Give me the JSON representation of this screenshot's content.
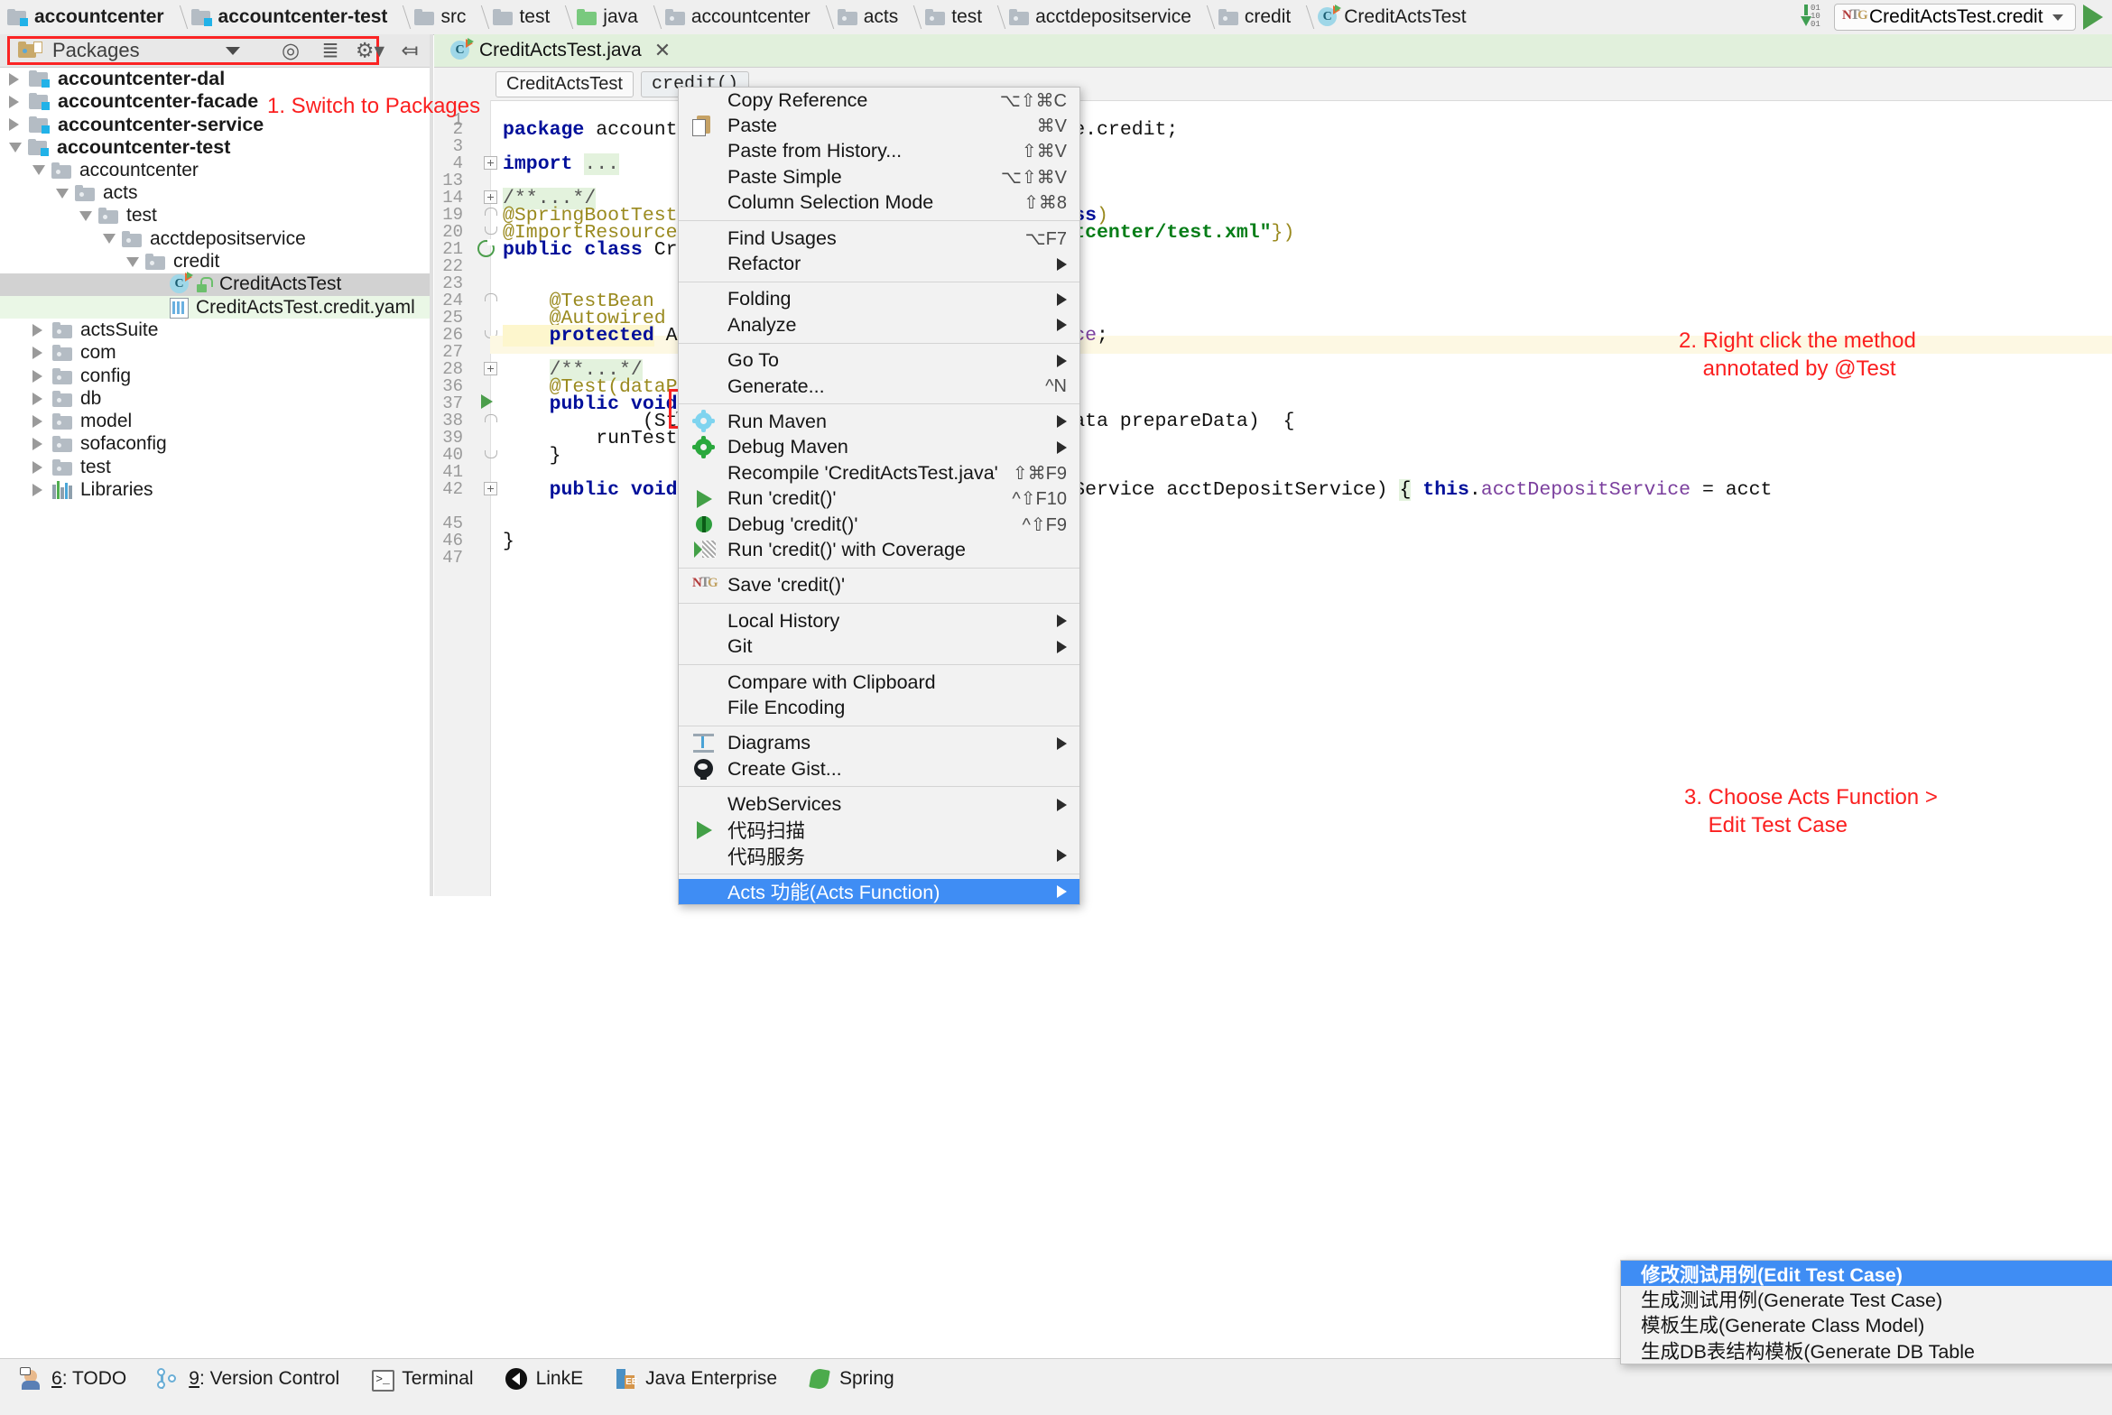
{
  "breadcrumb": [
    {
      "label": "accountcenter",
      "icon": "module-icon",
      "bold": true
    },
    {
      "label": "accountcenter-test",
      "icon": "module-icon",
      "bold": true
    },
    {
      "label": "src",
      "icon": "folder-icon",
      "bold": false
    },
    {
      "label": "test",
      "icon": "folder-icon",
      "bold": false
    },
    {
      "label": "java",
      "icon": "source-folder-icon",
      "bold": false
    },
    {
      "label": "accountcenter",
      "icon": "package-icon",
      "bold": false
    },
    {
      "label": "acts",
      "icon": "package-icon",
      "bold": false
    },
    {
      "label": "test",
      "icon": "package-icon",
      "bold": false
    },
    {
      "label": "acctdepositservice",
      "icon": "package-icon",
      "bold": false
    },
    {
      "label": "credit",
      "icon": "package-icon",
      "bold": false
    },
    {
      "label": "CreditActsTest",
      "icon": "java-class-icon",
      "bold": false
    }
  ],
  "toolbar": {
    "binary_icon": "binary-download-icon",
    "binary_bits": [
      "01",
      "10",
      "01"
    ],
    "run_config": "CreditActsTest.credit",
    "run_config_icon": "testng-icon",
    "run_button": "run-icon"
  },
  "project_panel": {
    "title": "Packages",
    "title_icon": "packages-icon",
    "chevron": "chevron-down-icon",
    "tools": [
      "locate-icon",
      "collapse-all-icon",
      "settings-icon",
      "hide-icon"
    ],
    "tree": [
      {
        "label": "accountcenter-dal",
        "depth": 0,
        "state": "collapsed",
        "icon": "module-icon",
        "bold": true
      },
      {
        "label": "accountcenter-facade",
        "depth": 0,
        "state": "collapsed",
        "icon": "module-icon",
        "bold": true
      },
      {
        "label": "accountcenter-service",
        "depth": 0,
        "state": "collapsed",
        "icon": "module-icon",
        "bold": true
      },
      {
        "label": "accountcenter-test",
        "depth": 0,
        "state": "expanded",
        "icon": "module-icon",
        "bold": true
      },
      {
        "label": "accountcenter",
        "depth": 1,
        "state": "expanded",
        "icon": "package-icon",
        "bold": false
      },
      {
        "label": "acts",
        "depth": 2,
        "state": "expanded",
        "icon": "package-icon",
        "bold": false
      },
      {
        "label": "test",
        "depth": 3,
        "state": "expanded",
        "icon": "package-icon",
        "bold": false
      },
      {
        "label": "acctdepositservice",
        "depth": 4,
        "state": "expanded",
        "icon": "package-icon",
        "bold": false
      },
      {
        "label": "credit",
        "depth": 5,
        "state": "expanded",
        "icon": "package-icon",
        "bold": false
      },
      {
        "label": "CreditActsTest",
        "depth": 6,
        "state": "leaf",
        "icon": "java-test-class-icon",
        "bold": false,
        "selected": true
      },
      {
        "label": "CreditActsTest.credit.yaml",
        "depth": 6,
        "state": "leaf",
        "icon": "yaml-table-icon",
        "bold": false,
        "highlighted": true
      },
      {
        "label": "actsSuite",
        "depth": 1,
        "state": "collapsed",
        "icon": "package-icon",
        "bold": false
      },
      {
        "label": "com",
        "depth": 1,
        "state": "collapsed",
        "icon": "package-icon",
        "bold": false
      },
      {
        "label": "config",
        "depth": 1,
        "state": "collapsed",
        "icon": "package-icon",
        "bold": false
      },
      {
        "label": "db",
        "depth": 1,
        "state": "collapsed",
        "icon": "package-icon",
        "bold": false
      },
      {
        "label": "model",
        "depth": 1,
        "state": "collapsed",
        "icon": "package-icon",
        "bold": false
      },
      {
        "label": "sofaconfig",
        "depth": 1,
        "state": "collapsed",
        "icon": "package-icon",
        "bold": false
      },
      {
        "label": "test",
        "depth": 1,
        "state": "collapsed",
        "icon": "package-icon",
        "bold": false
      },
      {
        "label": "Libraries",
        "depth": 1,
        "state": "collapsed",
        "icon": "libraries-icon",
        "bold": false
      }
    ]
  },
  "annotations": {
    "step1": "1. Switch to Packages",
    "step2": "2. Right click the method\n    annotated by @Test",
    "step3": "3. Choose Acts Function >\n    Edit Test Case"
  },
  "editor": {
    "tab": {
      "label": "CreditActsTest.java",
      "icon": "java-class-icon",
      "close": "close-icon"
    },
    "breadcrumb_chips": [
      "CreditActsTest",
      "credit()"
    ],
    "line_numbers": [
      "1",
      "2",
      "3",
      "4",
      "13",
      "14",
      "19",
      "20",
      "21",
      "22",
      "23",
      "24",
      "25",
      "26",
      "27",
      "28",
      "36",
      "37",
      "38",
      "39",
      "40",
      "41",
      "42",
      "45",
      "46",
      "47"
    ],
    "code_lines": [
      {
        "n": "2",
        "text": "package accountcenter.acts.test.acctdepositservice.credit;"
      },
      {
        "n": "4",
        "text": "import ..."
      },
      {
        "n": "14",
        "text": "/**...*/"
      },
      {
        "n": "19",
        "text": "@SpringBootTest(classes = SOFABootApplication.class)"
      },
      {
        "n": "20",
        "text": "@ImportResource({\"classpath*:test/META-INF/accountcenter/test.xml\"})"
      },
      {
        "n": "21",
        "text": "public class CreditActsTest extends ActsTestBase{"
      },
      {
        "n": "24",
        "text": "@TestBean"
      },
      {
        "n": "25",
        "text": "@Autowired"
      },
      {
        "n": "26",
        "text": "protected AcctDepositService acctDepositService;"
      },
      {
        "n": "28",
        "text": "/**...*/"
      },
      {
        "n": "36",
        "text": "@Test(dataProvider = \"ActsDataProvider\")"
      },
      {
        "n": "37",
        "text": "public void credit(String caseId, String desc, PrepareData prepareData)"
      },
      {
        "n": "38",
        "text": "(String caseId, String desc, PrepareData prepareData)"
      },
      {
        "n": "39",
        "text": "runTest(caseId, prepareData);"
      },
      {
        "n": "40",
        "text": "}"
      },
      {
        "n": "42",
        "text": "public void setAcctDepositService(AcctDepositService acctDepositService) { this.acctDepositService = acct"
      },
      {
        "n": "46",
        "text": "}"
      }
    ]
  },
  "context_menu": {
    "groups": [
      {
        "items": [
          {
            "label": "Copy Reference",
            "shortcut": "⌥⇧⌘C",
            "icon": null,
            "submenu": false
          },
          {
            "label": "Paste",
            "shortcut": "⌘V",
            "icon": "paste-icon",
            "submenu": false
          },
          {
            "label": "Paste from History...",
            "shortcut": "⇧⌘V",
            "icon": null,
            "submenu": false
          },
          {
            "label": "Paste Simple",
            "shortcut": "⌥⇧⌘V",
            "icon": null,
            "submenu": false
          },
          {
            "label": "Column Selection Mode",
            "shortcut": "⇧⌘8",
            "icon": null,
            "submenu": false
          }
        ]
      },
      {
        "items": [
          {
            "label": "Find Usages",
            "shortcut": "⌥F7",
            "icon": null,
            "submenu": false
          },
          {
            "label": "Refactor",
            "shortcut": "",
            "icon": null,
            "submenu": true
          }
        ]
      },
      {
        "items": [
          {
            "label": "Folding",
            "shortcut": "",
            "icon": null,
            "submenu": true
          },
          {
            "label": "Analyze",
            "shortcut": "",
            "icon": null,
            "submenu": true
          }
        ]
      },
      {
        "items": [
          {
            "label": "Go To",
            "shortcut": "",
            "icon": null,
            "submenu": true
          },
          {
            "label": "Generate...",
            "shortcut": "^N",
            "icon": null,
            "submenu": false
          }
        ]
      },
      {
        "items": [
          {
            "label": "Run Maven",
            "shortcut": "",
            "icon": "maven-run-icon",
            "submenu": true
          },
          {
            "label": "Debug Maven",
            "shortcut": "",
            "icon": "maven-debug-icon",
            "submenu": true
          },
          {
            "label": "Recompile 'CreditActsTest.java'",
            "shortcut": "⇧⌘F9",
            "icon": null,
            "submenu": false
          },
          {
            "label": "Run 'credit()'",
            "shortcut": "^⇧F10",
            "icon": "run-icon",
            "submenu": false
          },
          {
            "label": "Debug 'credit()'",
            "shortcut": "^⇧F9",
            "icon": "debug-icon",
            "submenu": false
          },
          {
            "label": "Run 'credit()' with Coverage",
            "shortcut": "",
            "icon": "coverage-icon",
            "submenu": false
          }
        ]
      },
      {
        "items": [
          {
            "label": "Save 'credit()'",
            "shortcut": "",
            "icon": "testng-icon",
            "submenu": false
          }
        ]
      },
      {
        "items": [
          {
            "label": "Local History",
            "shortcut": "",
            "icon": null,
            "submenu": true
          },
          {
            "label": "Git",
            "shortcut": "",
            "icon": null,
            "submenu": true
          }
        ]
      },
      {
        "items": [
          {
            "label": "Compare with Clipboard",
            "shortcut": "",
            "icon": null,
            "submenu": false
          },
          {
            "label": "File Encoding",
            "shortcut": "",
            "icon": null,
            "submenu": false
          }
        ]
      },
      {
        "items": [
          {
            "label": "Diagrams",
            "shortcut": "",
            "icon": "diagrams-icon",
            "submenu": true
          },
          {
            "label": "Create Gist...",
            "shortcut": "",
            "icon": "github-icon",
            "submenu": false
          }
        ]
      },
      {
        "items": [
          {
            "label": "WebServices",
            "shortcut": "",
            "icon": null,
            "submenu": true
          },
          {
            "label": "代码扫描",
            "shortcut": "",
            "icon": "run-icon",
            "submenu": false
          },
          {
            "label": "代码服务",
            "shortcut": "",
            "icon": null,
            "submenu": true
          }
        ]
      },
      {
        "items": [
          {
            "label": "Acts 功能(Acts Function)",
            "shortcut": "",
            "icon": null,
            "submenu": true,
            "highlighted": true
          }
        ]
      }
    ]
  },
  "submenu": {
    "items": [
      {
        "label": "修改测试用例(Edit Test Case)",
        "highlighted": true
      },
      {
        "label": "生成测试用例(Generate Test Case)",
        "highlighted": false
      },
      {
        "label": "模板生成(Generate Class Model)",
        "highlighted": false
      },
      {
        "label": "生成DB表结构模板(Generate DB Table",
        "highlighted": false
      }
    ]
  },
  "status_bar": {
    "items": [
      {
        "label": "6: TODO",
        "underline": "6",
        "icon": "todo-icon"
      },
      {
        "label": "9: Version Control",
        "underline": "9",
        "icon": "version-control-icon"
      },
      {
        "label": "Terminal",
        "underline": "",
        "icon": "terminal-icon"
      },
      {
        "label": "LinkE",
        "underline": "",
        "icon": "linke-icon"
      },
      {
        "label": "Java Enterprise",
        "underline": "",
        "icon": "java-enterprise-icon"
      },
      {
        "label": "Spring",
        "underline": "",
        "icon": "spring-icon"
      }
    ]
  },
  "colors": {
    "accent": "#3f8df4",
    "annotation_red": "#fb1f1f",
    "selection_green": "#eaf7e6",
    "highlight_line": "#fdf8e3"
  }
}
